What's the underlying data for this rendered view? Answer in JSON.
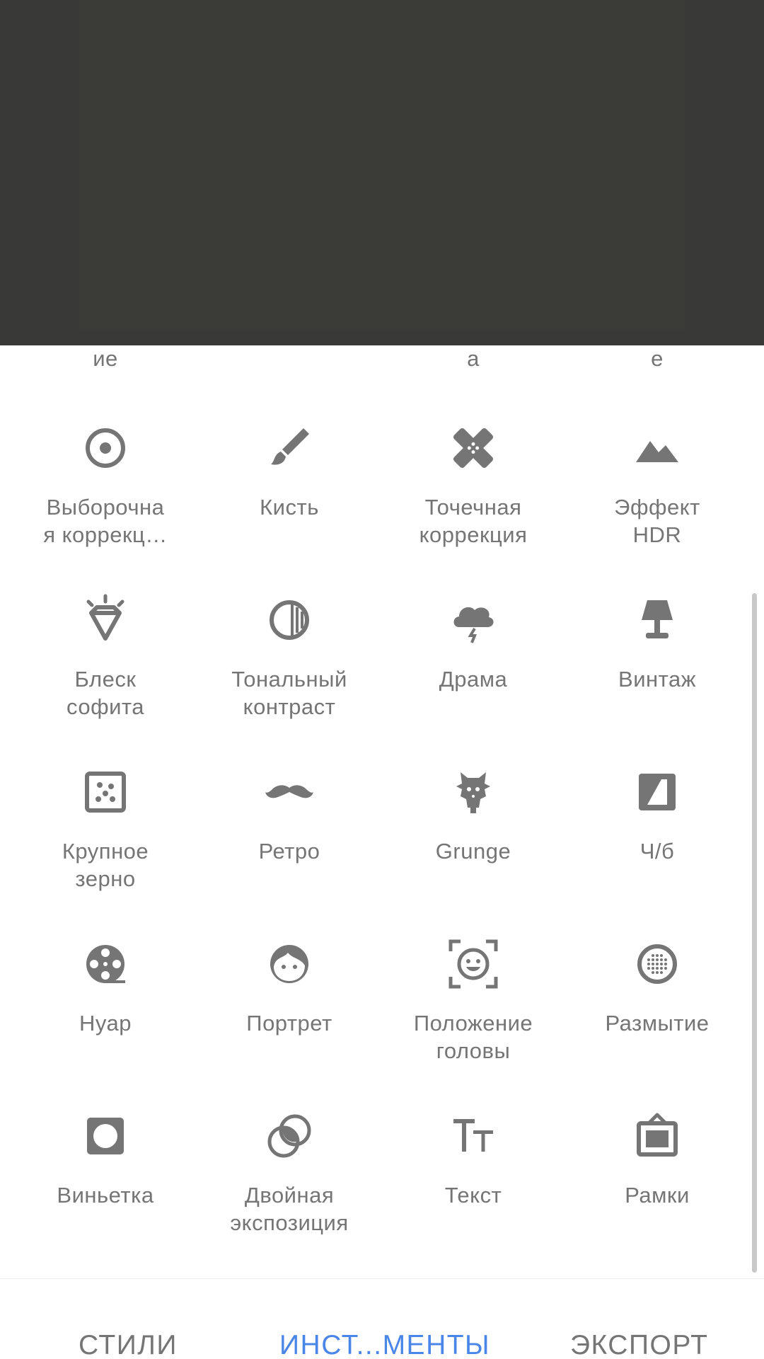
{
  "partial_labels": [
    "ие",
    "а",
    "е"
  ],
  "tools": [
    {
      "label": "Выборочна\nя коррекц…",
      "icon": "selective-icon"
    },
    {
      "label": "Кисть",
      "icon": "brush-icon"
    },
    {
      "label": "Точечная\nкоррекция",
      "icon": "healing-icon"
    },
    {
      "label": "Эффект\nHDR",
      "icon": "hdr-icon"
    },
    {
      "label": "Блеск\nсофита",
      "icon": "glamour-glow-icon"
    },
    {
      "label": "Тональный\nконтраст",
      "icon": "tonal-contrast-icon"
    },
    {
      "label": "Драма",
      "icon": "drama-icon"
    },
    {
      "label": "Винтаж",
      "icon": "vintage-icon"
    },
    {
      "label": "Крупное\nзерно",
      "icon": "grainy-film-icon"
    },
    {
      "label": "Ретро",
      "icon": "retrolux-icon"
    },
    {
      "label": "Grunge",
      "icon": "grunge-icon"
    },
    {
      "label": "Ч/б",
      "icon": "black-white-icon"
    },
    {
      "label": "Нуар",
      "icon": "noir-icon"
    },
    {
      "label": "Портрет",
      "icon": "portrait-icon"
    },
    {
      "label": "Положение\nголовы",
      "icon": "head-pose-icon"
    },
    {
      "label": "Размытие",
      "icon": "lens-blur-icon"
    },
    {
      "label": "Виньетка",
      "icon": "vignette-icon"
    },
    {
      "label": "Двойная\nэкспозиция",
      "icon": "double-exposure-icon"
    },
    {
      "label": "Текст",
      "icon": "text-icon"
    },
    {
      "label": "Рамки",
      "icon": "frames-icon"
    }
  ],
  "nav": {
    "styles": "СТИЛИ",
    "tools": "ИНСТ...МЕНТЫ",
    "export": "ЭКСПОРТ"
  },
  "colors": {
    "accent": "#4a86e8",
    "icon": "#757575",
    "photo_bg": "#393937"
  }
}
